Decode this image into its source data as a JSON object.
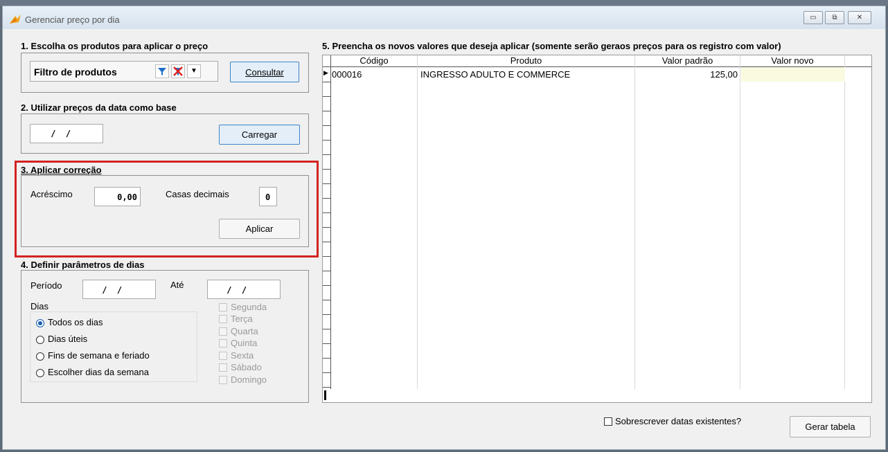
{
  "window": {
    "title": "Gerenciar preço por dia"
  },
  "section1": {
    "title": "1. Escolha os produtos para aplicar o preço",
    "filter_label": "Filtro de produtos",
    "consult_label": "Consultar"
  },
  "section2": {
    "title": "2. Utilizar preços da data como base",
    "date_value": " /  /",
    "load_label": "Carregar"
  },
  "section3": {
    "title": "3. Aplicar correção",
    "increase_label": "Acréscimo",
    "increase_value": "0,00",
    "decimals_label": "Casas decimais",
    "decimals_value": "0",
    "apply_label": "Aplicar"
  },
  "section4": {
    "title": "4. Definir parâmetros de dias",
    "period_label": "Período",
    "period_value": " /  /",
    "until_label": "Até",
    "until_value": " /  /",
    "days_label": "Dias",
    "radio_options": [
      "Todos os dias",
      "Dias úteis",
      "Fins de semana e feriado",
      "Escolher dias da semana"
    ],
    "selected_radio": "Todos os dias",
    "weekdays": [
      "Segunda",
      "Terça",
      "Quarta",
      "Quinta",
      "Sexta",
      "Sábado",
      "Domingo"
    ]
  },
  "section5": {
    "title": "5. Preencha os novos valores que deseja aplicar (somente serão geraos preços para os registro com valor)",
    "columns": [
      "Código",
      "Produto",
      "Valor padrão",
      "Valor novo"
    ],
    "rows": [
      {
        "codigo": "000016",
        "produto": "INGRESSO ADULTO E COMMERCE",
        "valor_padrao": "125,00",
        "valor_novo": ""
      }
    ]
  },
  "footer": {
    "overwrite_label": "Sobrescrever datas existentes?",
    "overwrite_checked": false,
    "generate_label": "Gerar tabela"
  },
  "colors": {
    "highlight": "#d42222",
    "accent": "#1a5fb4",
    "new_value_cell": "#fafae0"
  },
  "icons": [
    "app-logo-icon",
    "minimize-icon",
    "restore-icon",
    "close-icon",
    "filter-icon",
    "clear-filter-icon",
    "dropdown-arrow-icon",
    "row-pointer-icon"
  ]
}
